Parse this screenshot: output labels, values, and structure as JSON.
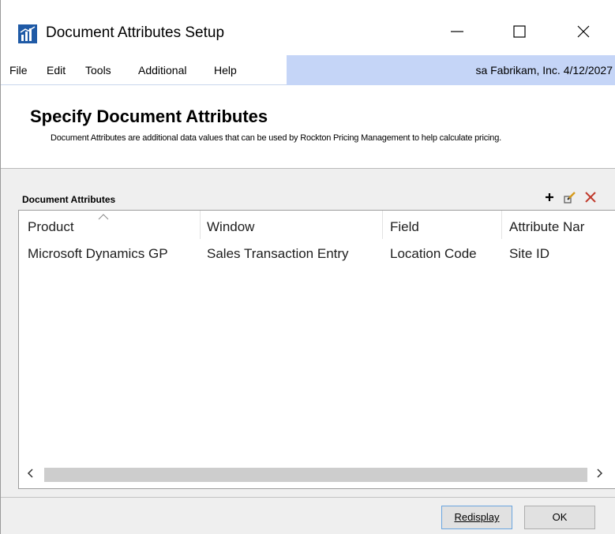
{
  "window": {
    "title": "Document Attributes Setup",
    "minimize_icon": "minimize-icon",
    "maximize_icon": "maximize-icon",
    "close_icon": "close-icon"
  },
  "menu": {
    "items": [
      "File",
      "Edit",
      "Tools",
      "Additional",
      "Help"
    ],
    "user_info": "sa  Fabrikam, Inc.  4/12/2027"
  },
  "header": {
    "title": "Specify Document Attributes",
    "description": "Document Attributes are additional data values that can be used by Rockton Pricing Management to help calculate pricing."
  },
  "section": {
    "label": "Document Attributes",
    "tools": [
      "add-icon",
      "edit-icon",
      "delete-icon"
    ]
  },
  "grid": {
    "columns": [
      "Product",
      "Window",
      "Field",
      "Attribute Nar"
    ],
    "rows": [
      [
        "Microsoft Dynamics GP",
        "Sales Transaction Entry",
        "Location Code",
        "Site ID"
      ]
    ]
  },
  "buttons": {
    "redisplay": "Redisplay",
    "ok": "OK"
  },
  "colors": {
    "user_strip": "#c5d5f7",
    "delete_icon": "#c0392b",
    "button_focus": "#6aa5df"
  }
}
